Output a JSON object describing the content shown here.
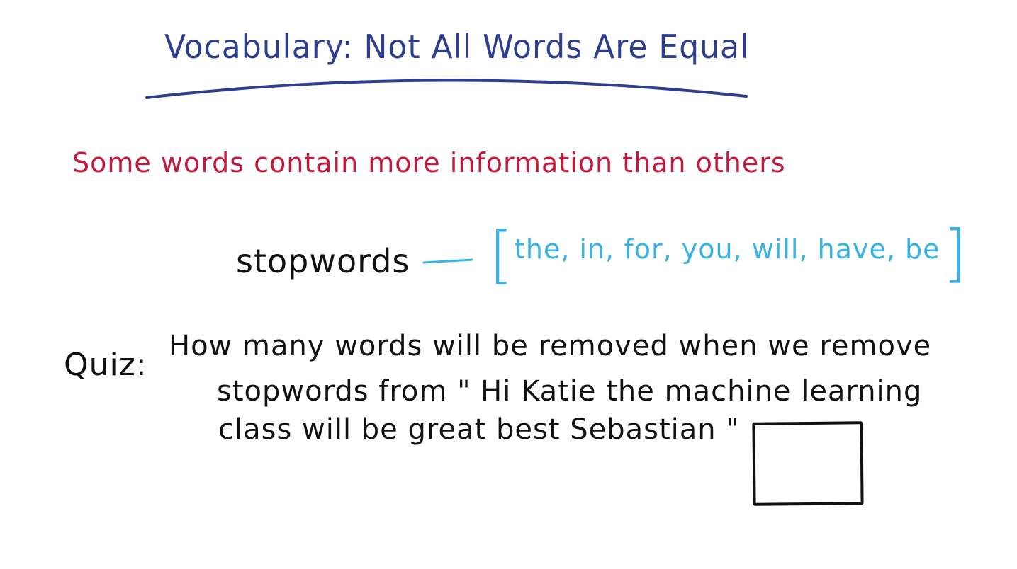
{
  "title": "Vocabulary: Not All Words Are Equal",
  "subtitle": "Some words contain more information than others",
  "stopwords": {
    "label": "stopwords",
    "bracket_open": "[",
    "list": "the, in, for, you, will, have, be",
    "bracket_close": "]"
  },
  "quiz": {
    "label": "Quiz:",
    "lines": [
      "How many words will be removed when we remove",
      "stopwords from \" Hi Katie the machine learning",
      "class will be great best Sebastian \""
    ]
  },
  "colors": {
    "title": "#2d3e8f",
    "subtitle": "#c2183c",
    "stopwords_list": "#39b3e6",
    "body": "#111111"
  }
}
